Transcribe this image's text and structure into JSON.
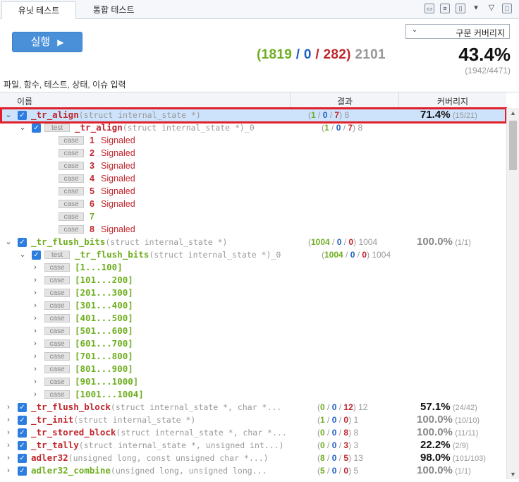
{
  "tabs": [
    {
      "label": "유닛 테스트"
    },
    {
      "label": "통합 테스트"
    }
  ],
  "toolbar": {
    "icons": [
      "window-icon",
      "filter-icon",
      "export-icon",
      "dropdown-icon",
      "minimize-icon",
      "maximize-icon"
    ]
  },
  "run_button": {
    "label": "실행",
    "glyph": "▶"
  },
  "coverage_select": {
    "value": "구문 커버리지"
  },
  "summary": {
    "open": "(",
    "passed": "1819",
    "sep1": "/",
    "failed": "0",
    "sep2": "/",
    "error": "282",
    "close": ")",
    "total": "2101"
  },
  "total_coverage": {
    "percent": "43.4%",
    "fraction": "(1942/4471)"
  },
  "filter": {
    "placeholder": "파일, 함수, 테스트, 상태, 이슈 입력"
  },
  "columns": {
    "name": "이름",
    "result": "결과",
    "coverage": "커버리지"
  },
  "rows": [
    {
      "kind": "func",
      "expanded": true,
      "name": "_tr_align",
      "sig": "(struct internal_state *)",
      "color": "red",
      "res": [
        "1",
        "0",
        "7",
        "8"
      ],
      "cov": "71.4%",
      "covf": "(15/21)",
      "covgray": false
    },
    {
      "kind": "test",
      "expanded": true,
      "name": "_tr_align",
      "sig": "(struct internal_state *)_0",
      "color": "red",
      "res": [
        "1",
        "0",
        "7",
        "8"
      ],
      "cov": "",
      "covf": ""
    },
    {
      "kind": "case",
      "num": "1",
      "status": "Signaled",
      "color": "red"
    },
    {
      "kind": "case",
      "num": "2",
      "status": "Signaled",
      "color": "red"
    },
    {
      "kind": "case",
      "num": "3",
      "status": "Signaled",
      "color": "red"
    },
    {
      "kind": "case",
      "num": "4",
      "status": "Signaled",
      "color": "red"
    },
    {
      "kind": "case",
      "num": "5",
      "status": "Signaled",
      "color": "red"
    },
    {
      "kind": "case",
      "num": "6",
      "status": "Signaled",
      "color": "red"
    },
    {
      "kind": "case",
      "num": "7",
      "status": "",
      "color": "green"
    },
    {
      "kind": "case",
      "num": "8",
      "status": "Signaled",
      "color": "red"
    },
    {
      "kind": "func",
      "expanded": true,
      "name": "_tr_flush_bits",
      "sig": "(struct internal_state *)",
      "color": "green",
      "res": [
        "1004",
        "0",
        "0",
        "1004"
      ],
      "cov": "100.0%",
      "covf": "(1/1)",
      "covgray": true
    },
    {
      "kind": "test",
      "expanded": true,
      "name": "_tr_flush_bits",
      "sig": "(struct internal_state *)_0",
      "color": "green",
      "res": [
        "1004",
        "0",
        "0",
        "1004"
      ],
      "cov": "",
      "covf": ""
    },
    {
      "kind": "range",
      "label": "[1...100]"
    },
    {
      "kind": "range",
      "label": "[101...200]"
    },
    {
      "kind": "range",
      "label": "[201...300]"
    },
    {
      "kind": "range",
      "label": "[301...400]"
    },
    {
      "kind": "range",
      "label": "[401...500]"
    },
    {
      "kind": "range",
      "label": "[501...600]"
    },
    {
      "kind": "range",
      "label": "[601...700]"
    },
    {
      "kind": "range",
      "label": "[701...800]"
    },
    {
      "kind": "range",
      "label": "[801...900]"
    },
    {
      "kind": "range",
      "label": "[901...1000]"
    },
    {
      "kind": "range",
      "label": "[1001...1004]"
    },
    {
      "kind": "func",
      "expanded": false,
      "name": "_tr_flush_block",
      "sig": "(struct internal_state *, char *...",
      "color": "red",
      "res": [
        "0",
        "0",
        "12",
        "12"
      ],
      "cov": "57.1%",
      "covf": "(24/42)",
      "covgray": false
    },
    {
      "kind": "func",
      "expanded": false,
      "name": "_tr_init",
      "sig": "(struct internal_state *)",
      "color": "red",
      "res": [
        "1",
        "0",
        "0",
        "1"
      ],
      "cov": "100.0%",
      "covf": "(10/10)",
      "covgray": true
    },
    {
      "kind": "func",
      "expanded": false,
      "name": "_tr_stored_block",
      "sig": "(struct internal_state *, char *...",
      "color": "red",
      "res": [
        "0",
        "0",
        "8",
        "8"
      ],
      "cov": "100.0%",
      "covf": "(11/11)",
      "covgray": true
    },
    {
      "kind": "func",
      "expanded": false,
      "name": "_tr_tally",
      "sig": "(struct internal_state *, unsigned int...)",
      "color": "red",
      "res": [
        "0",
        "0",
        "3",
        "3"
      ],
      "cov": "22.2%",
      "covf": "(2/9)",
      "covgray": false
    },
    {
      "kind": "func",
      "expanded": false,
      "name": "adler32",
      "sig": "(unsigned long, const unsigned char *...)",
      "color": "red",
      "res": [
        "8",
        "0",
        "5",
        "13"
      ],
      "cov": "98.0%",
      "covf": "(101/103)",
      "covgray": false
    },
    {
      "kind": "func",
      "expanded": false,
      "name": "adler32_combine",
      "sig": "(unsigned long, unsigned long...",
      "color": "green",
      "res": [
        "5",
        "0",
        "0",
        "5"
      ],
      "cov": "100.0%",
      "covf": "(1/1)",
      "covgray": true
    }
  ],
  "badges": {
    "test": "test",
    "case": "case"
  },
  "colors": {
    "pass": "#6fae20",
    "fail": "#1f5fc2",
    "error": "#c0262d",
    "accent": "#4a90d9",
    "highlight": "#e0202a"
  }
}
